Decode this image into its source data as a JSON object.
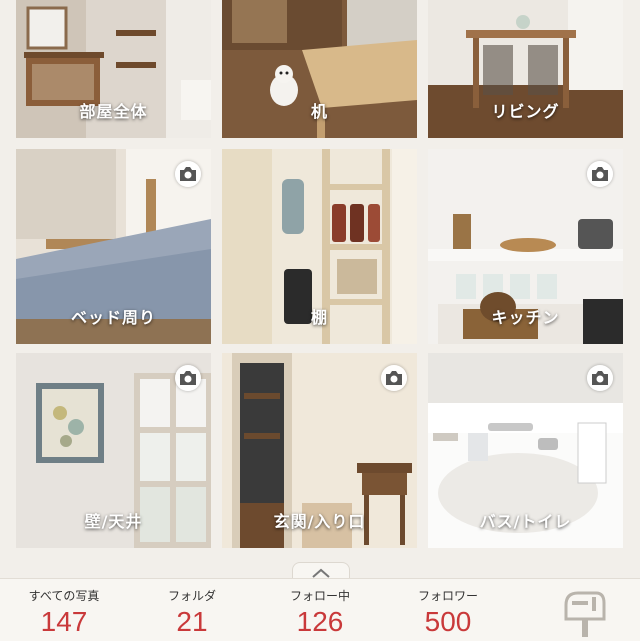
{
  "folders": [
    {
      "label": "部屋全体",
      "has_camera": false,
      "palette": [
        "#d9d3cb",
        "#7a5436",
        "#b79a7e"
      ]
    },
    {
      "label": "机",
      "has_camera": false,
      "palette": [
        "#8a6443",
        "#d6b889",
        "#5c4330"
      ]
    },
    {
      "label": "リビング",
      "has_camera": false,
      "palette": [
        "#eae6e0",
        "#6b4a2f",
        "#c8bdb0"
      ]
    },
    {
      "label": "ベッド周り",
      "has_camera": true,
      "palette": [
        "#eee8e0",
        "#9aa7bb",
        "#b48c5b"
      ]
    },
    {
      "label": "棚",
      "has_camera": false,
      "palette": [
        "#efe9dc",
        "#c9b89a",
        "#7a3a2a"
      ]
    },
    {
      "label": "キッチン",
      "has_camera": true,
      "palette": [
        "#f1efec",
        "#d9d4cc",
        "#7f5b35"
      ]
    },
    {
      "label": "壁/天井",
      "has_camera": true,
      "palette": [
        "#e9e5e0",
        "#6c7d86",
        "#d8d1c6"
      ]
    },
    {
      "label": "玄関/入り口",
      "has_camera": true,
      "palette": [
        "#efe7d8",
        "#6d4a2e",
        "#c7a77e"
      ]
    },
    {
      "label": "バス/トイレ",
      "has_camera": true,
      "palette": [
        "#f3f2f0",
        "#d8d6d2",
        "#b0aaa2"
      ]
    }
  ],
  "stats": [
    {
      "label": "すべての写真",
      "value": "147"
    },
    {
      "label": "フォルダ",
      "value": "21"
    },
    {
      "label": "フォロー中",
      "value": "126"
    },
    {
      "label": "フォロワー",
      "value": "500"
    }
  ],
  "colors": {
    "accent": "#c9393a",
    "background": "#f2efea"
  },
  "icons": {
    "camera": "camera-icon",
    "handle": "chevron-up-icon",
    "mailbox": "mailbox-icon"
  }
}
